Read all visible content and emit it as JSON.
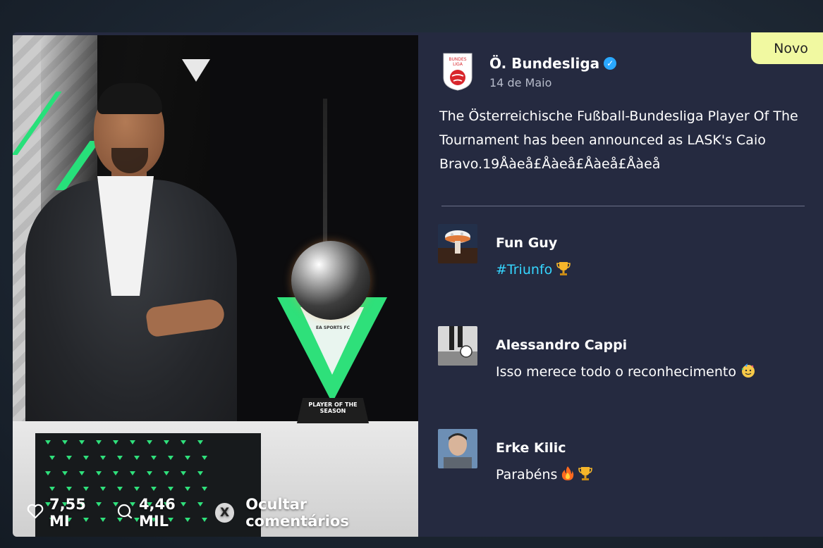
{
  "post": {
    "author": "Ö. Bundesliga",
    "date": "14 de Maio",
    "body": "The Österreichische Fußball-Bundesliga Player Of The Tournament has been announced as LASK's Caio Bravo.19Åàeå£Åàeå£Åàeå£Åàeå",
    "badge": "Novo",
    "logo_text": "BUNDES LIGA"
  },
  "image": {
    "trophy_label": "PLAYER OF THE SEASON",
    "trophy_brand": "EA SPORTS FC"
  },
  "stats": {
    "likes": "7,55 MI",
    "comments": "4,46 MIL",
    "hide_key": "X",
    "hide_label": "Ocultar comentários"
  },
  "comments": [
    {
      "name": "Fun Guy",
      "hashtag": "#Triunfo",
      "text": "",
      "emoji": "trophy-icon"
    },
    {
      "name": "Alessandro Cappi",
      "text": "Isso merece todo o reconhecimento",
      "emoji": "party-face-icon"
    },
    {
      "name": "Erke Kilic",
      "text": "Parabéns",
      "emoji": "fire-trophy-icon"
    }
  ],
  "colors": {
    "accent_green": "#2ee07a",
    "badge_bg": "#f1f9a1",
    "hashtag": "#35d6ff",
    "panel_bg": "#252a40",
    "verified": "#2aa8ff"
  }
}
